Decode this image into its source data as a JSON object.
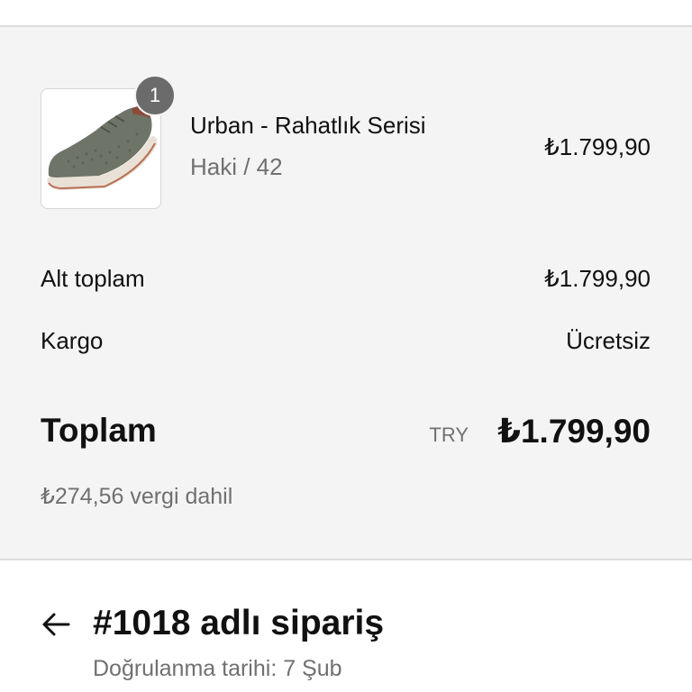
{
  "order_summary": {
    "line_items": [
      {
        "quantity": "1",
        "name": "Urban - Rahatlık Serisi",
        "variant": "Haki / 42",
        "price": "₺1.799,90",
        "image": "khaki-sneaker-image"
      }
    ],
    "subtotal": {
      "label": "Alt toplam",
      "value": "₺1.799,90"
    },
    "shipping": {
      "label": "Kargo",
      "value": "Ücretsiz"
    },
    "total": {
      "label": "Toplam",
      "currency": "TRY",
      "value": "₺1.799,90"
    },
    "tax_note": "₺274,56 vergi dahil"
  },
  "order_header": {
    "back_icon": "arrow-left-icon",
    "title": "#1018 adlı sipariş",
    "confirmation_date": "Doğrulanma tarihi: 7 Şub"
  },
  "colors": {
    "summary_background": "#f4f4f4",
    "badge": "#6b6b6b",
    "muted_text": "#707070",
    "divider": "#dcdcdc"
  }
}
